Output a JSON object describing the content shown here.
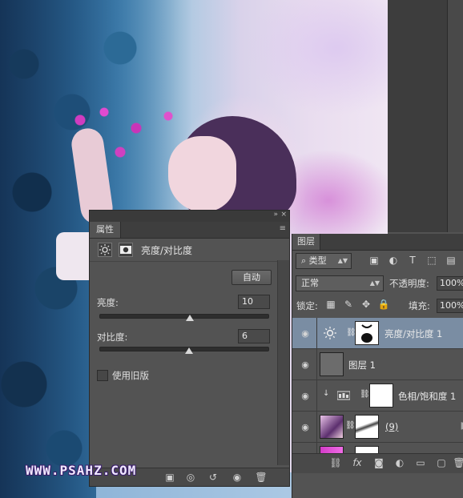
{
  "properties_panel": {
    "tab_label": "属性",
    "collapse_glyph": "»",
    "close_glyph": "×",
    "menu_glyph": "≡",
    "adjustment_title": "亮度/对比度",
    "auto_button": "自动",
    "brightness_label": "亮度:",
    "brightness_value": "10",
    "brightness_level": 10,
    "contrast_label": "对比度:",
    "contrast_value": "6",
    "contrast_level": 6,
    "legacy_label": "使用旧版",
    "legacy_checked": false,
    "bottom_icons": [
      "clip-to-layer-icon",
      "view-previous-state-icon",
      "reset-icon",
      "visibility-icon",
      "trash-icon"
    ]
  },
  "layers_panel": {
    "tab_label": "图层",
    "filter_kind": "类型",
    "blend_mode": "正常",
    "opacity_label": "不透明度:",
    "opacity_value": "100%",
    "lock_label": "锁定:",
    "fill_label": "填充:",
    "fill_value": "100%",
    "layers": [
      {
        "name": "亮度/对比度 1",
        "type": "adjustment-brightness-contrast",
        "visible": true,
        "selected": true
      },
      {
        "name": "图层 1",
        "type": "pixel",
        "visible": true,
        "selected": false
      },
      {
        "name": "色相/饱和度 1",
        "type": "adjustment-hue-saturation",
        "visible": true,
        "selected": false,
        "clipped": true
      },
      {
        "name": "(9)",
        "type": "smart-masked",
        "visible": true,
        "selected": false
      }
    ],
    "bottom_icons": [
      "link-layers-icon",
      "fx-icon",
      "add-mask-icon",
      "adjustment-layer-icon",
      "new-group-icon",
      "new-layer-icon",
      "delete-layer-icon"
    ]
  },
  "watermark": "WWW.PSAHZ.COM",
  "colors": {
    "panel_bg": "#535353",
    "selected_row": "#7a8da3"
  }
}
